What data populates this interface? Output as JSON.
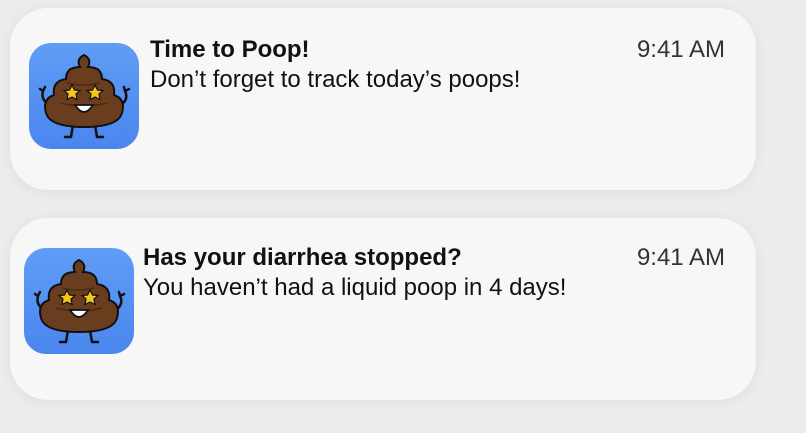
{
  "notifications": [
    {
      "title": "Time to Poop!",
      "message": "Don’t forget to track today’s poops!",
      "time": "9:41 AM",
      "icon": "poop-mascot-icon"
    },
    {
      "title": "Has your diarrhea stopped?",
      "message": "You haven’t had a liquid poop in 4 days!",
      "time": "9:41 AM",
      "icon": "poop-mascot-icon"
    }
  ],
  "colors": {
    "icon_background": "#4f8ef0",
    "card_background": "#f7f7f7",
    "poop_brown": "#6b3d1f",
    "star_yellow": "#f5c518"
  }
}
